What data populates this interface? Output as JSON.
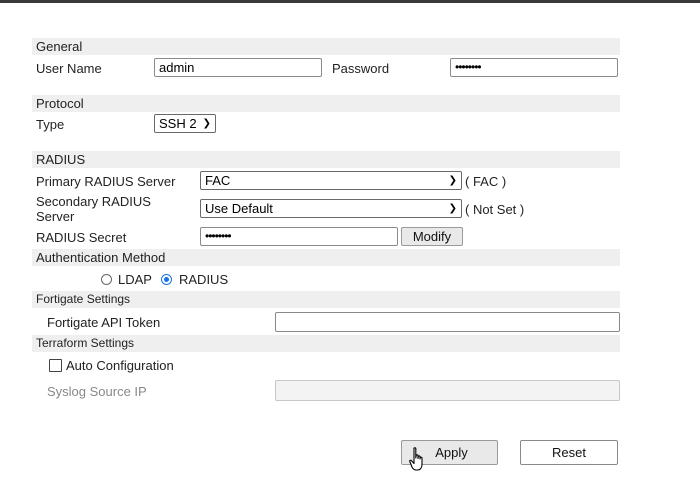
{
  "general": {
    "header": "General",
    "username_label": "User Name",
    "username_value": "admin",
    "password_label": "Password",
    "password_value": "••••••••"
  },
  "protocol": {
    "header": "Protocol",
    "type_label": "Type",
    "type_value": "SSH 2"
  },
  "radius": {
    "header": "RADIUS",
    "primary_label": "Primary RADIUS Server",
    "primary_value": "FAC",
    "primary_note": "( FAC )",
    "secondary_label": "Secondary RADIUS Server",
    "secondary_value": "Use Default",
    "secondary_note": "( Not Set )",
    "secret_label": "RADIUS Secret",
    "secret_value": "••••••••",
    "modify_label": "Modify"
  },
  "auth": {
    "header": "Authentication Method",
    "ldap_label": "LDAP",
    "radius_label": "RADIUS",
    "selected": "RADIUS"
  },
  "fortigate": {
    "header": "Fortigate Settings",
    "token_label": "Fortigate API Token",
    "token_value": ""
  },
  "terraform": {
    "header": "Terraform Settings",
    "auto_config_label": "Auto Configuration",
    "auto_config_checked": false,
    "syslog_label": "Syslog Source IP",
    "syslog_value": ""
  },
  "actions": {
    "apply_label": "Apply",
    "reset_label": "Reset"
  },
  "colors": {
    "accent": "#1a73e8",
    "section_bg": "#efefef"
  },
  "icons": {
    "cursor": "hand-pointer-icon",
    "dropdown": "chevron-down-icon"
  }
}
